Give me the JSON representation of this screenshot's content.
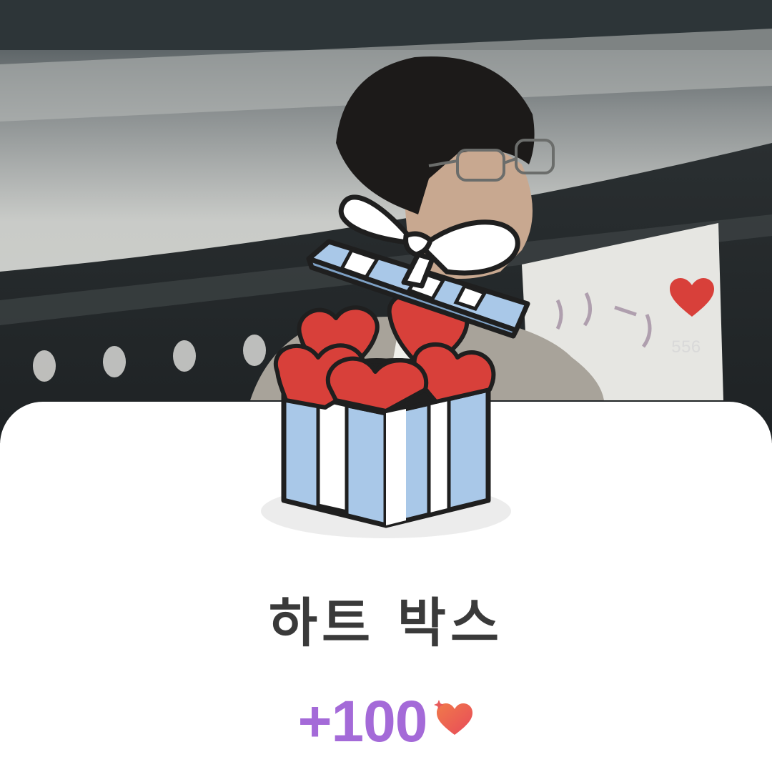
{
  "video": {
    "like_count": "556",
    "like_color": "#d8403a"
  },
  "reward": {
    "title": "하트 박스",
    "amount": "+100",
    "amount_color": "#a46ad8",
    "icon": "heart-icon"
  },
  "gift_box": {
    "icon": "gift-box-icon",
    "box_color": "#a9c8e8",
    "heart_color": "#d8403a",
    "ribbon_color": "#ffffff"
  }
}
